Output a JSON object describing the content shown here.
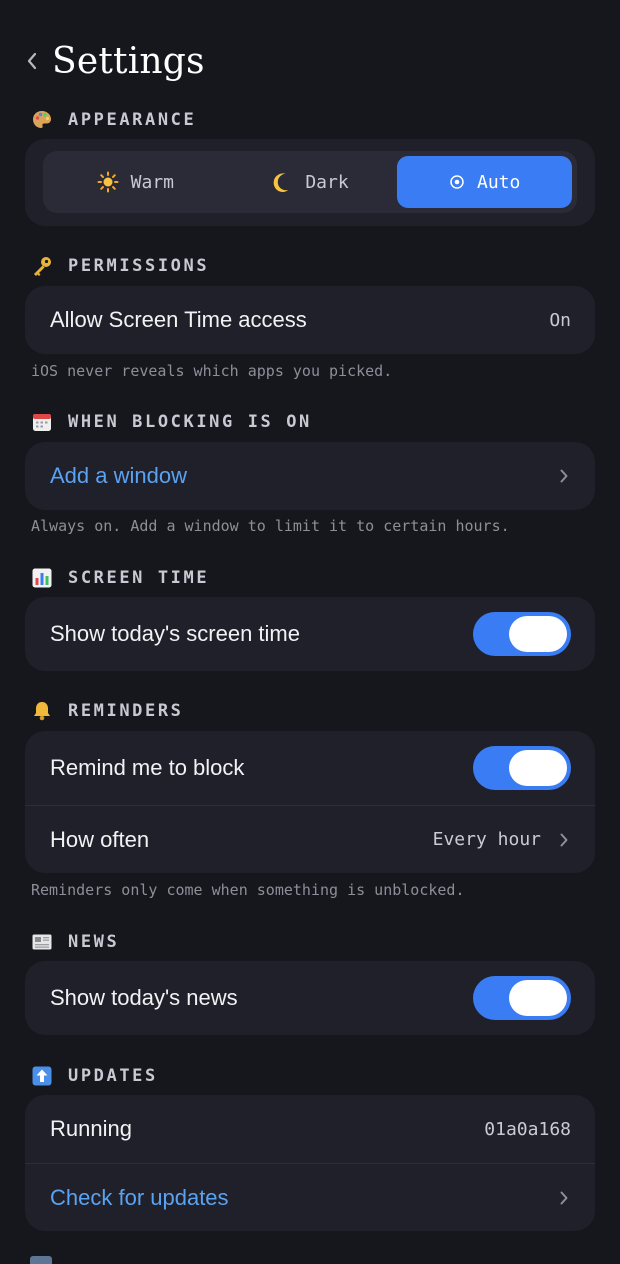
{
  "header": {
    "title": "Settings"
  },
  "sections": {
    "appearance": {
      "title": "APPEARANCE",
      "icon": "palette-icon",
      "options": [
        {
          "label": "Warm",
          "icon": "sun-icon"
        },
        {
          "label": "Dark",
          "icon": "moon-icon"
        },
        {
          "label": "Auto",
          "icon": "auto-icon"
        }
      ],
      "selected": "Auto"
    },
    "permissions": {
      "title": "PERMISSIONS",
      "icon": "key-icon",
      "row_label": "Allow Screen Time access",
      "row_value": "On",
      "footnote": "iOS never reveals which apps you picked."
    },
    "blocking": {
      "title": "WHEN BLOCKING IS ON",
      "icon": "calendar-icon",
      "row_label": "Add a window",
      "footnote": "Always on. Add a window to limit it to certain hours."
    },
    "screen_time": {
      "title": "SCREEN TIME",
      "icon": "bar-chart-icon",
      "row_label": "Show today's screen time",
      "toggle_on": true
    },
    "reminders": {
      "title": "REMINDERS",
      "icon": "bell-icon",
      "remind_label": "Remind me to block",
      "remind_on": true,
      "often_label": "How often",
      "often_value": "Every hour",
      "footnote": "Reminders only come when something is unblocked."
    },
    "news": {
      "title": "NEWS",
      "icon": "newspaper-icon",
      "row_label": "Show today's news",
      "toggle_on": true
    },
    "updates": {
      "title": "UPDATES",
      "icon": "up-arrow-icon",
      "running_label": "Running",
      "running_value": "01a0a168",
      "check_label": "Check for updates"
    }
  },
  "colors": {
    "background": "#16161d",
    "card": "#1f2029",
    "accent": "#3a7cf3",
    "link": "#5aa2f2"
  }
}
